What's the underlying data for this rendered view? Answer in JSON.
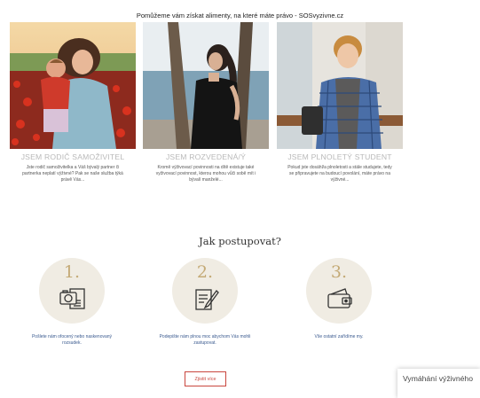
{
  "banner": {
    "text": "Pomůžeme vám získat alimenty, na které máte právo - SOSvyzivne.cz"
  },
  "cards": [
    {
      "title": "JSEM RODIČ SAMOŽIVITEL",
      "desc": "Jste rodič samoživitelka a Váš bývalý partner či partnerka neplatí výživné? Pak se naše služba týká právě Vás..."
    },
    {
      "title": "JSEM ROZVEDENÁ/Ý",
      "desc": "Kromě výživovací povinnosti na dítě existuje také vyživovací povinnost, kterou mohou vůči sobě mít i bývalí manželé..."
    },
    {
      "title": "JSEM PLNOLETÝ STUDENT",
      "desc": "Pokud jste dosáhl/a plnoletosti a stále studujete, tedy se připravujete na budoucí povolání, máte právo na výživné..."
    }
  ],
  "how": {
    "title": "Jak postupovat?",
    "steps": [
      {
        "num": "1.",
        "icon": "camera-document-icon",
        "text": "Pošlete nám ofocený nebo naskenovaný rozsudek."
      },
      {
        "num": "2.",
        "icon": "sign-document-icon",
        "text": "Podepište nám plnou moc abychom Vás mohli zastupovat."
      },
      {
        "num": "3.",
        "icon": "wallet-icon",
        "text": "Vše ostatní zařídíme my."
      }
    ]
  },
  "more_button": "Zjistit více",
  "chat": {
    "label": "Vymáhání výživného"
  },
  "colors": {
    "accent_gold": "#c4aa76",
    "circle_bg": "#f0ece3",
    "link_blue": "#3a5a8f",
    "button_red": "#c9463e"
  }
}
